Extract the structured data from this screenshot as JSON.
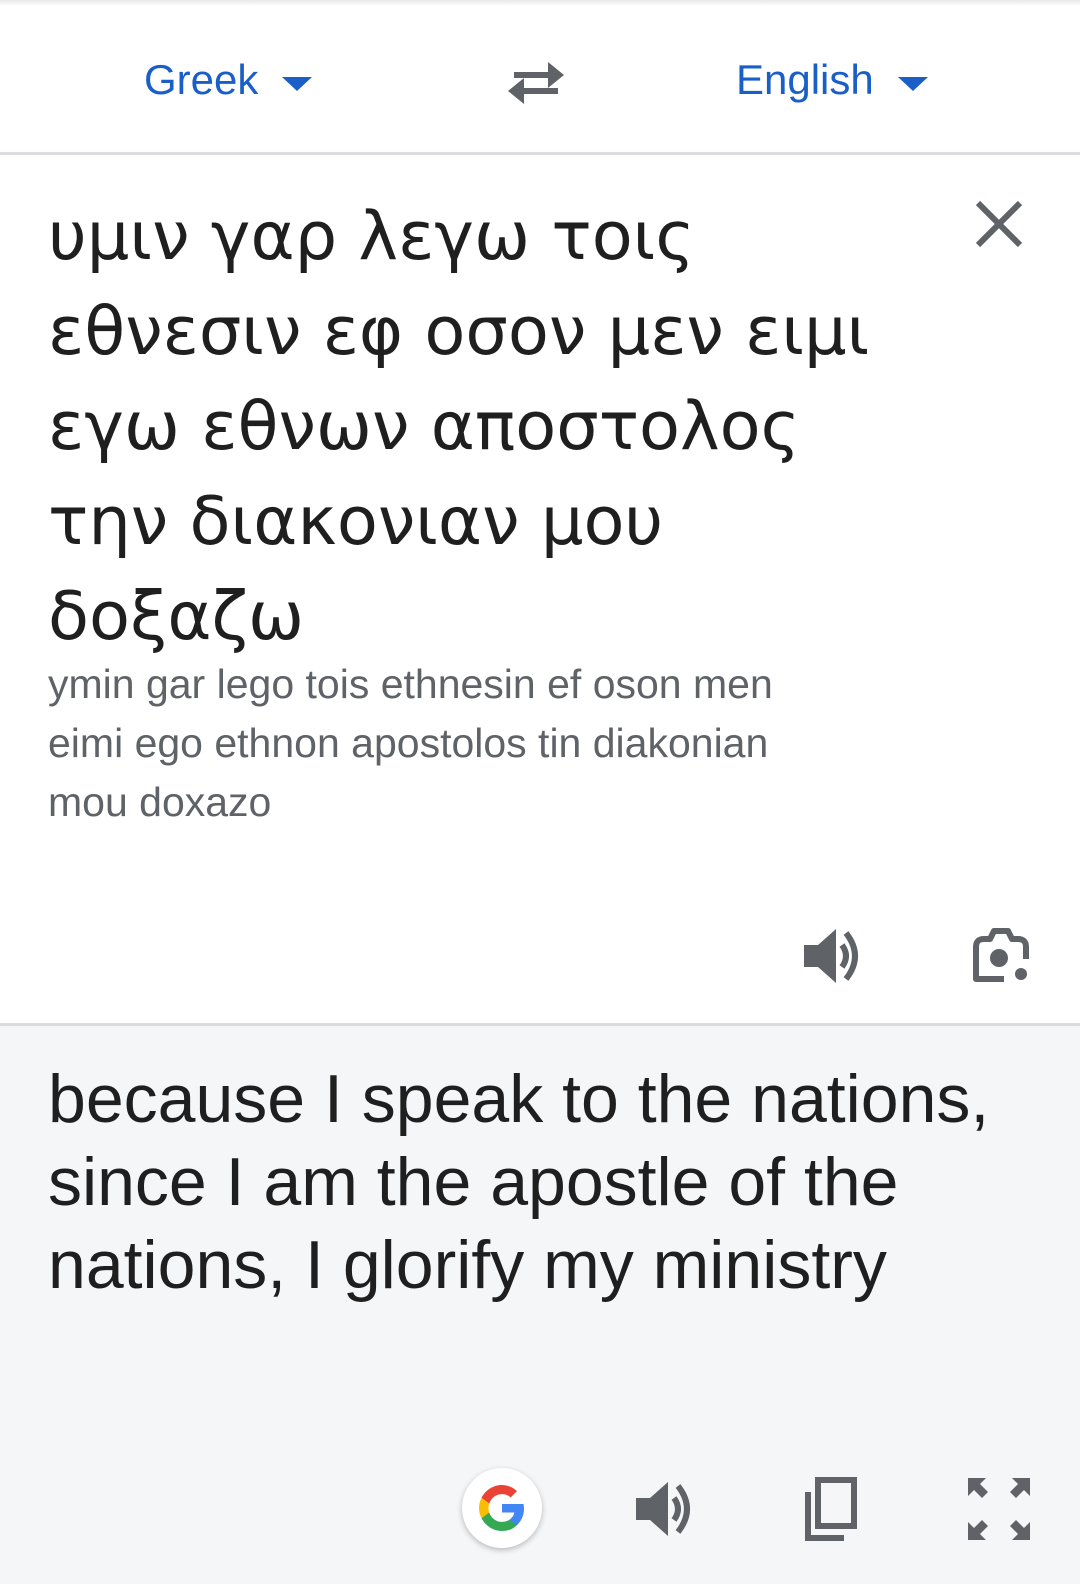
{
  "language_bar": {
    "source_language": "Greek",
    "target_language": "English",
    "swap_icon": "swap-arrows-icon",
    "accent_color": "#1a5fc8"
  },
  "source": {
    "text": "υμιν γαρ λεγω τοις εθνεσιν εφ οσον μεν ειμι εγω εθνων αποστολος την διακονιαν μου δοξαζω",
    "transliteration": "ymin gar lego tois ethnesin ef oson men eimi ego ethnon apostolos tin diakonian mou doxazo",
    "icons": [
      "close-icon",
      "speaker-icon",
      "camera-icon"
    ]
  },
  "result": {
    "text": "because I speak to the nations, since I am the apostle of the nations, I glorify my ministry",
    "icons": [
      "google-icon",
      "speaker-icon",
      "copy-icon",
      "fullscreen-icon"
    ]
  }
}
